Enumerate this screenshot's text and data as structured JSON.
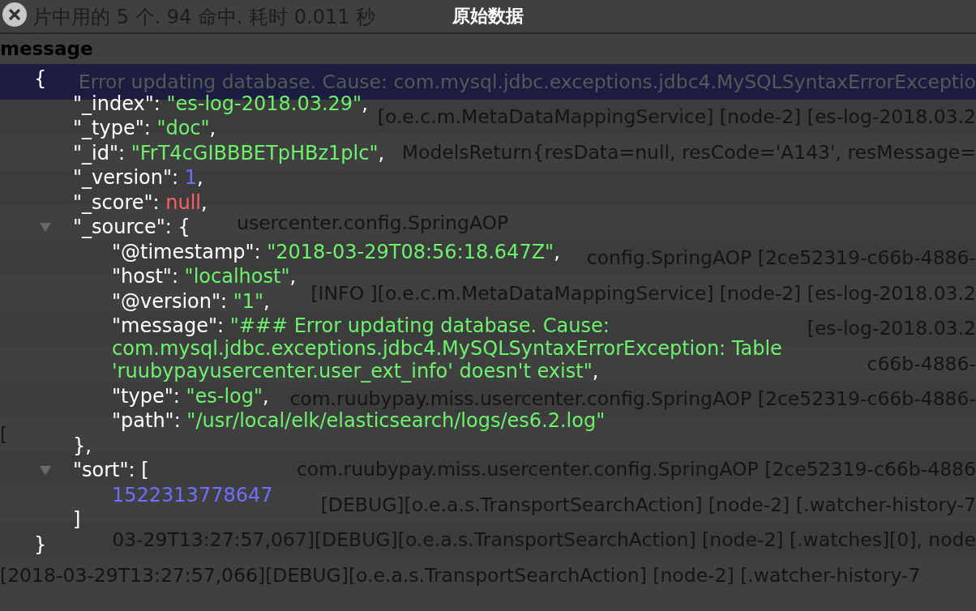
{
  "page": {
    "summary": "片中用的 5 个. 94 命中. 耗时 0.011 秒",
    "column_header": "message",
    "rows": [
      {
        "text": "Error updating database. Cause: com.mysql.jdbc.exceptions.jdbc4.MySQLSyntaxErrorExceptio",
        "selected": true
      },
      {
        "text": "[o.e.c.m.MetaDataMappingService] [node-2] [es-log-2018.03.2",
        "selected": false
      },
      {
        "text": "ModelsReturn{resData=null, resCode='A143', resMessage=",
        "selected": false
      },
      {
        "text": "usercenter.config.SpringAOP",
        "selected": false
      },
      {
        "text": "config.SpringAOP [2ce52319-c66b-4886-",
        "selected": false
      },
      {
        "text": "[INFO ][o.e.c.m.MetaDataMappingService] [node-2] [es-log-2018.03.2",
        "selected": false
      },
      {
        "text": "[es-log-2018.03.2",
        "selected": false
      },
      {
        "text": "c66b-4886-",
        "selected": false
      },
      {
        "text": "com.ruubypay.miss.usercenter.config.SpringAOP [2ce52319-c66b-4886-",
        "selected": false
      },
      {
        "text": "[",
        "selected": false
      },
      {
        "text": "com.ruubypay.miss.usercenter.config.SpringAOP [2ce52319-c66b-4886",
        "selected": false
      },
      {
        "text": "[DEBUG][o.e.a.s.TransportSearchAction] [node-2] [.watcher-history-7",
        "selected": false
      },
      {
        "text": "03-29T13:27:57,067][DEBUG][o.e.a.s.TransportSearchAction] [node-2] [.watches][0], node",
        "selected": false
      },
      {
        "text": "[2018-03-29T13:27:57,066][DEBUG][o.e.a.s.TransportSearchAction] [node-2] [.watcher-history-7",
        "selected": false
      }
    ]
  },
  "dialog": {
    "title": "原始数据",
    "document": {
      "key": "{",
      "close": "}",
      "children": [
        {
          "key": "\"_index\": ",
          "value": "\"es-log-2018.03.29\"",
          "kind": "string",
          "tail": ","
        },
        {
          "key": "\"_type\": ",
          "value": "\"doc\"",
          "kind": "string",
          "tail": ","
        },
        {
          "key": "\"_id\": ",
          "value": "\"FrT4cGIBBBETpHBz1plc\"",
          "kind": "string",
          "tail": ","
        },
        {
          "key": "\"_version\": ",
          "value": "1",
          "kind": "number",
          "tail": ","
        },
        {
          "key": "\"_score\": ",
          "value": "null",
          "kind": "null",
          "tail": ","
        },
        {
          "key": "\"_source\": {",
          "close": "},",
          "expanded": true,
          "children": [
            {
              "key": "\"@timestamp\": ",
              "value": "\"2018-03-29T08:56:18.647Z\"",
              "kind": "string",
              "tail": ","
            },
            {
              "key": "\"host\": ",
              "value": "\"localhost\"",
              "kind": "string",
              "tail": ","
            },
            {
              "key": "\"@version\": ",
              "value": "\"1\"",
              "kind": "string",
              "tail": ","
            },
            {
              "key": "\"message\": ",
              "value": "\"### Error updating database. Cause: com.mysql.jdbc.exceptions.jdbc4.MySQLSyntaxErrorException: Table 'ruubypayusercenter.user_ext_info' doesn't exist\"",
              "kind": "string",
              "tail": ","
            },
            {
              "key": "\"type\": ",
              "value": "\"es-log\"",
              "kind": "string",
              "tail": ","
            },
            {
              "key": "\"path\": ",
              "value": "\"/usr/local/elk/elasticsearch/logs/es6.2.log\"",
              "kind": "string"
            }
          ]
        },
        {
          "key": "\"sort\": [",
          "close": "]",
          "expanded": true,
          "children": [
            {
              "value": "1522313778647",
              "kind": "number"
            }
          ]
        }
      ]
    }
  }
}
